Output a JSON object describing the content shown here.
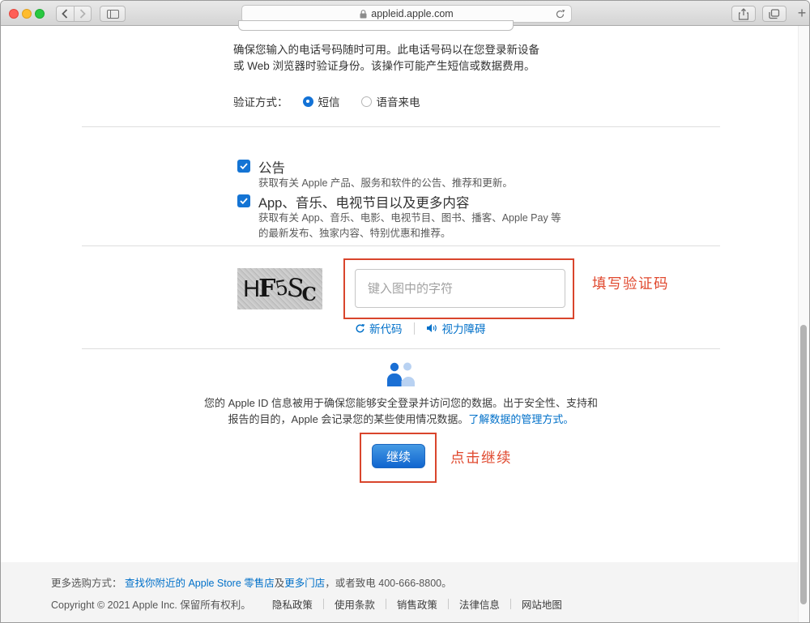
{
  "browser": {
    "url": "appleid.apple.com",
    "new_tab_glyph": "+"
  },
  "icons": {
    "lock": "lock-icon",
    "reload": "reload-icon",
    "share": "share-icon",
    "tabs": "tab-overview-icon",
    "sidebar": "sidebar-icon",
    "back": "chevron-left-icon",
    "forward": "chevron-right-icon",
    "new_code": "refresh-icon",
    "audio": "speaker-icon",
    "people": "two-people-icon",
    "check": "checkmark-icon"
  },
  "page": {
    "intro": {
      "line1": "确保您输入的电话号码随时可用。此电话号码以在您登录新设备",
      "line2": "或 Web 浏览器时验证身份。该操作可能产生短信或数据费用。"
    },
    "verification": {
      "label": "验证方式：",
      "options": [
        {
          "label": "短信",
          "selected": true
        },
        {
          "label": "语音来电",
          "selected": false
        }
      ]
    },
    "subscriptions": [
      {
        "title": "公告",
        "desc": "获取有关 Apple 产品、服务和软件的公告、推荐和更新。",
        "checked": true
      },
      {
        "title": "App、音乐、电视节目以及更多内容",
        "desc": "获取有关 App、音乐、电影、电视节目、图书、播客、Apple Pay 等的最新发布、独家内容、特别优惠和推荐。",
        "checked": true
      }
    ],
    "captcha": {
      "code": "HF5SC",
      "placeholder": "键入图中的字符",
      "new_code_label": "新代码",
      "audio_label": "视力障碍"
    },
    "privacy": {
      "line1": "您的 Apple ID 信息被用于确保您能够安全登录并访问您的数据。出于安全性、支持和",
      "line2_prefix": "报告的目的，Apple 会记录您的某些使用情况数据。",
      "line2_link": "了解数据的管理方式。"
    },
    "continue_label": "继续",
    "annotations": {
      "captcha_note": "填写验证码",
      "continue_note": "点击继续"
    }
  },
  "footer": {
    "line1_prefix": "更多选购方式： ",
    "line1_link1": "查找你附近的 Apple Store 零售店",
    "line1_mid": "及",
    "line1_link2": "更多门店",
    "line1_suffix": "，或者致电 400-666-8800。",
    "copyright": "Copyright © 2021 Apple Inc. 保留所有权利。",
    "links": [
      "隐私政策",
      "使用条款",
      "销售政策",
      "法律信息",
      "网站地图"
    ]
  },
  "colors": {
    "annotation_red": "#d9452c",
    "link_blue": "#0070c9",
    "control_blue": "#1474d4"
  }
}
